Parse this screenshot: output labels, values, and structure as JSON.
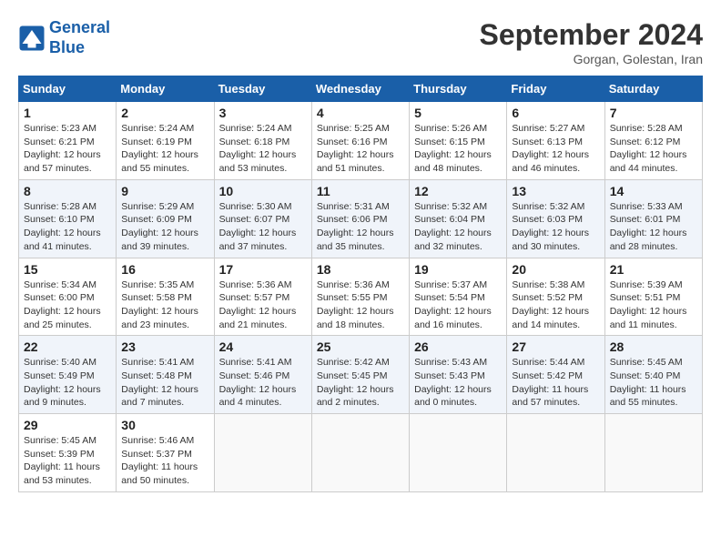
{
  "header": {
    "logo_line1": "General",
    "logo_line2": "Blue",
    "month_title": "September 2024",
    "subtitle": "Gorgan, Golestan, Iran"
  },
  "weekdays": [
    "Sunday",
    "Monday",
    "Tuesday",
    "Wednesday",
    "Thursday",
    "Friday",
    "Saturday"
  ],
  "weeks": [
    [
      {
        "day": "1",
        "info": "Sunrise: 5:23 AM\nSunset: 6:21 PM\nDaylight: 12 hours and 57 minutes."
      },
      {
        "day": "2",
        "info": "Sunrise: 5:24 AM\nSunset: 6:19 PM\nDaylight: 12 hours and 55 minutes."
      },
      {
        "day": "3",
        "info": "Sunrise: 5:24 AM\nSunset: 6:18 PM\nDaylight: 12 hours and 53 minutes."
      },
      {
        "day": "4",
        "info": "Sunrise: 5:25 AM\nSunset: 6:16 PM\nDaylight: 12 hours and 51 minutes."
      },
      {
        "day": "5",
        "info": "Sunrise: 5:26 AM\nSunset: 6:15 PM\nDaylight: 12 hours and 48 minutes."
      },
      {
        "day": "6",
        "info": "Sunrise: 5:27 AM\nSunset: 6:13 PM\nDaylight: 12 hours and 46 minutes."
      },
      {
        "day": "7",
        "info": "Sunrise: 5:28 AM\nSunset: 6:12 PM\nDaylight: 12 hours and 44 minutes."
      }
    ],
    [
      {
        "day": "8",
        "info": "Sunrise: 5:28 AM\nSunset: 6:10 PM\nDaylight: 12 hours and 41 minutes."
      },
      {
        "day": "9",
        "info": "Sunrise: 5:29 AM\nSunset: 6:09 PM\nDaylight: 12 hours and 39 minutes."
      },
      {
        "day": "10",
        "info": "Sunrise: 5:30 AM\nSunset: 6:07 PM\nDaylight: 12 hours and 37 minutes."
      },
      {
        "day": "11",
        "info": "Sunrise: 5:31 AM\nSunset: 6:06 PM\nDaylight: 12 hours and 35 minutes."
      },
      {
        "day": "12",
        "info": "Sunrise: 5:32 AM\nSunset: 6:04 PM\nDaylight: 12 hours and 32 minutes."
      },
      {
        "day": "13",
        "info": "Sunrise: 5:32 AM\nSunset: 6:03 PM\nDaylight: 12 hours and 30 minutes."
      },
      {
        "day": "14",
        "info": "Sunrise: 5:33 AM\nSunset: 6:01 PM\nDaylight: 12 hours and 28 minutes."
      }
    ],
    [
      {
        "day": "15",
        "info": "Sunrise: 5:34 AM\nSunset: 6:00 PM\nDaylight: 12 hours and 25 minutes."
      },
      {
        "day": "16",
        "info": "Sunrise: 5:35 AM\nSunset: 5:58 PM\nDaylight: 12 hours and 23 minutes."
      },
      {
        "day": "17",
        "info": "Sunrise: 5:36 AM\nSunset: 5:57 PM\nDaylight: 12 hours and 21 minutes."
      },
      {
        "day": "18",
        "info": "Sunrise: 5:36 AM\nSunset: 5:55 PM\nDaylight: 12 hours and 18 minutes."
      },
      {
        "day": "19",
        "info": "Sunrise: 5:37 AM\nSunset: 5:54 PM\nDaylight: 12 hours and 16 minutes."
      },
      {
        "day": "20",
        "info": "Sunrise: 5:38 AM\nSunset: 5:52 PM\nDaylight: 12 hours and 14 minutes."
      },
      {
        "day": "21",
        "info": "Sunrise: 5:39 AM\nSunset: 5:51 PM\nDaylight: 12 hours and 11 minutes."
      }
    ],
    [
      {
        "day": "22",
        "info": "Sunrise: 5:40 AM\nSunset: 5:49 PM\nDaylight: 12 hours and 9 minutes."
      },
      {
        "day": "23",
        "info": "Sunrise: 5:41 AM\nSunset: 5:48 PM\nDaylight: 12 hours and 7 minutes."
      },
      {
        "day": "24",
        "info": "Sunrise: 5:41 AM\nSunset: 5:46 PM\nDaylight: 12 hours and 4 minutes."
      },
      {
        "day": "25",
        "info": "Sunrise: 5:42 AM\nSunset: 5:45 PM\nDaylight: 12 hours and 2 minutes."
      },
      {
        "day": "26",
        "info": "Sunrise: 5:43 AM\nSunset: 5:43 PM\nDaylight: 12 hours and 0 minutes."
      },
      {
        "day": "27",
        "info": "Sunrise: 5:44 AM\nSunset: 5:42 PM\nDaylight: 11 hours and 57 minutes."
      },
      {
        "day": "28",
        "info": "Sunrise: 5:45 AM\nSunset: 5:40 PM\nDaylight: 11 hours and 55 minutes."
      }
    ],
    [
      {
        "day": "29",
        "info": "Sunrise: 5:45 AM\nSunset: 5:39 PM\nDaylight: 11 hours and 53 minutes."
      },
      {
        "day": "30",
        "info": "Sunrise: 5:46 AM\nSunset: 5:37 PM\nDaylight: 11 hours and 50 minutes."
      },
      {
        "day": "",
        "info": ""
      },
      {
        "day": "",
        "info": ""
      },
      {
        "day": "",
        "info": ""
      },
      {
        "day": "",
        "info": ""
      },
      {
        "day": "",
        "info": ""
      }
    ]
  ]
}
